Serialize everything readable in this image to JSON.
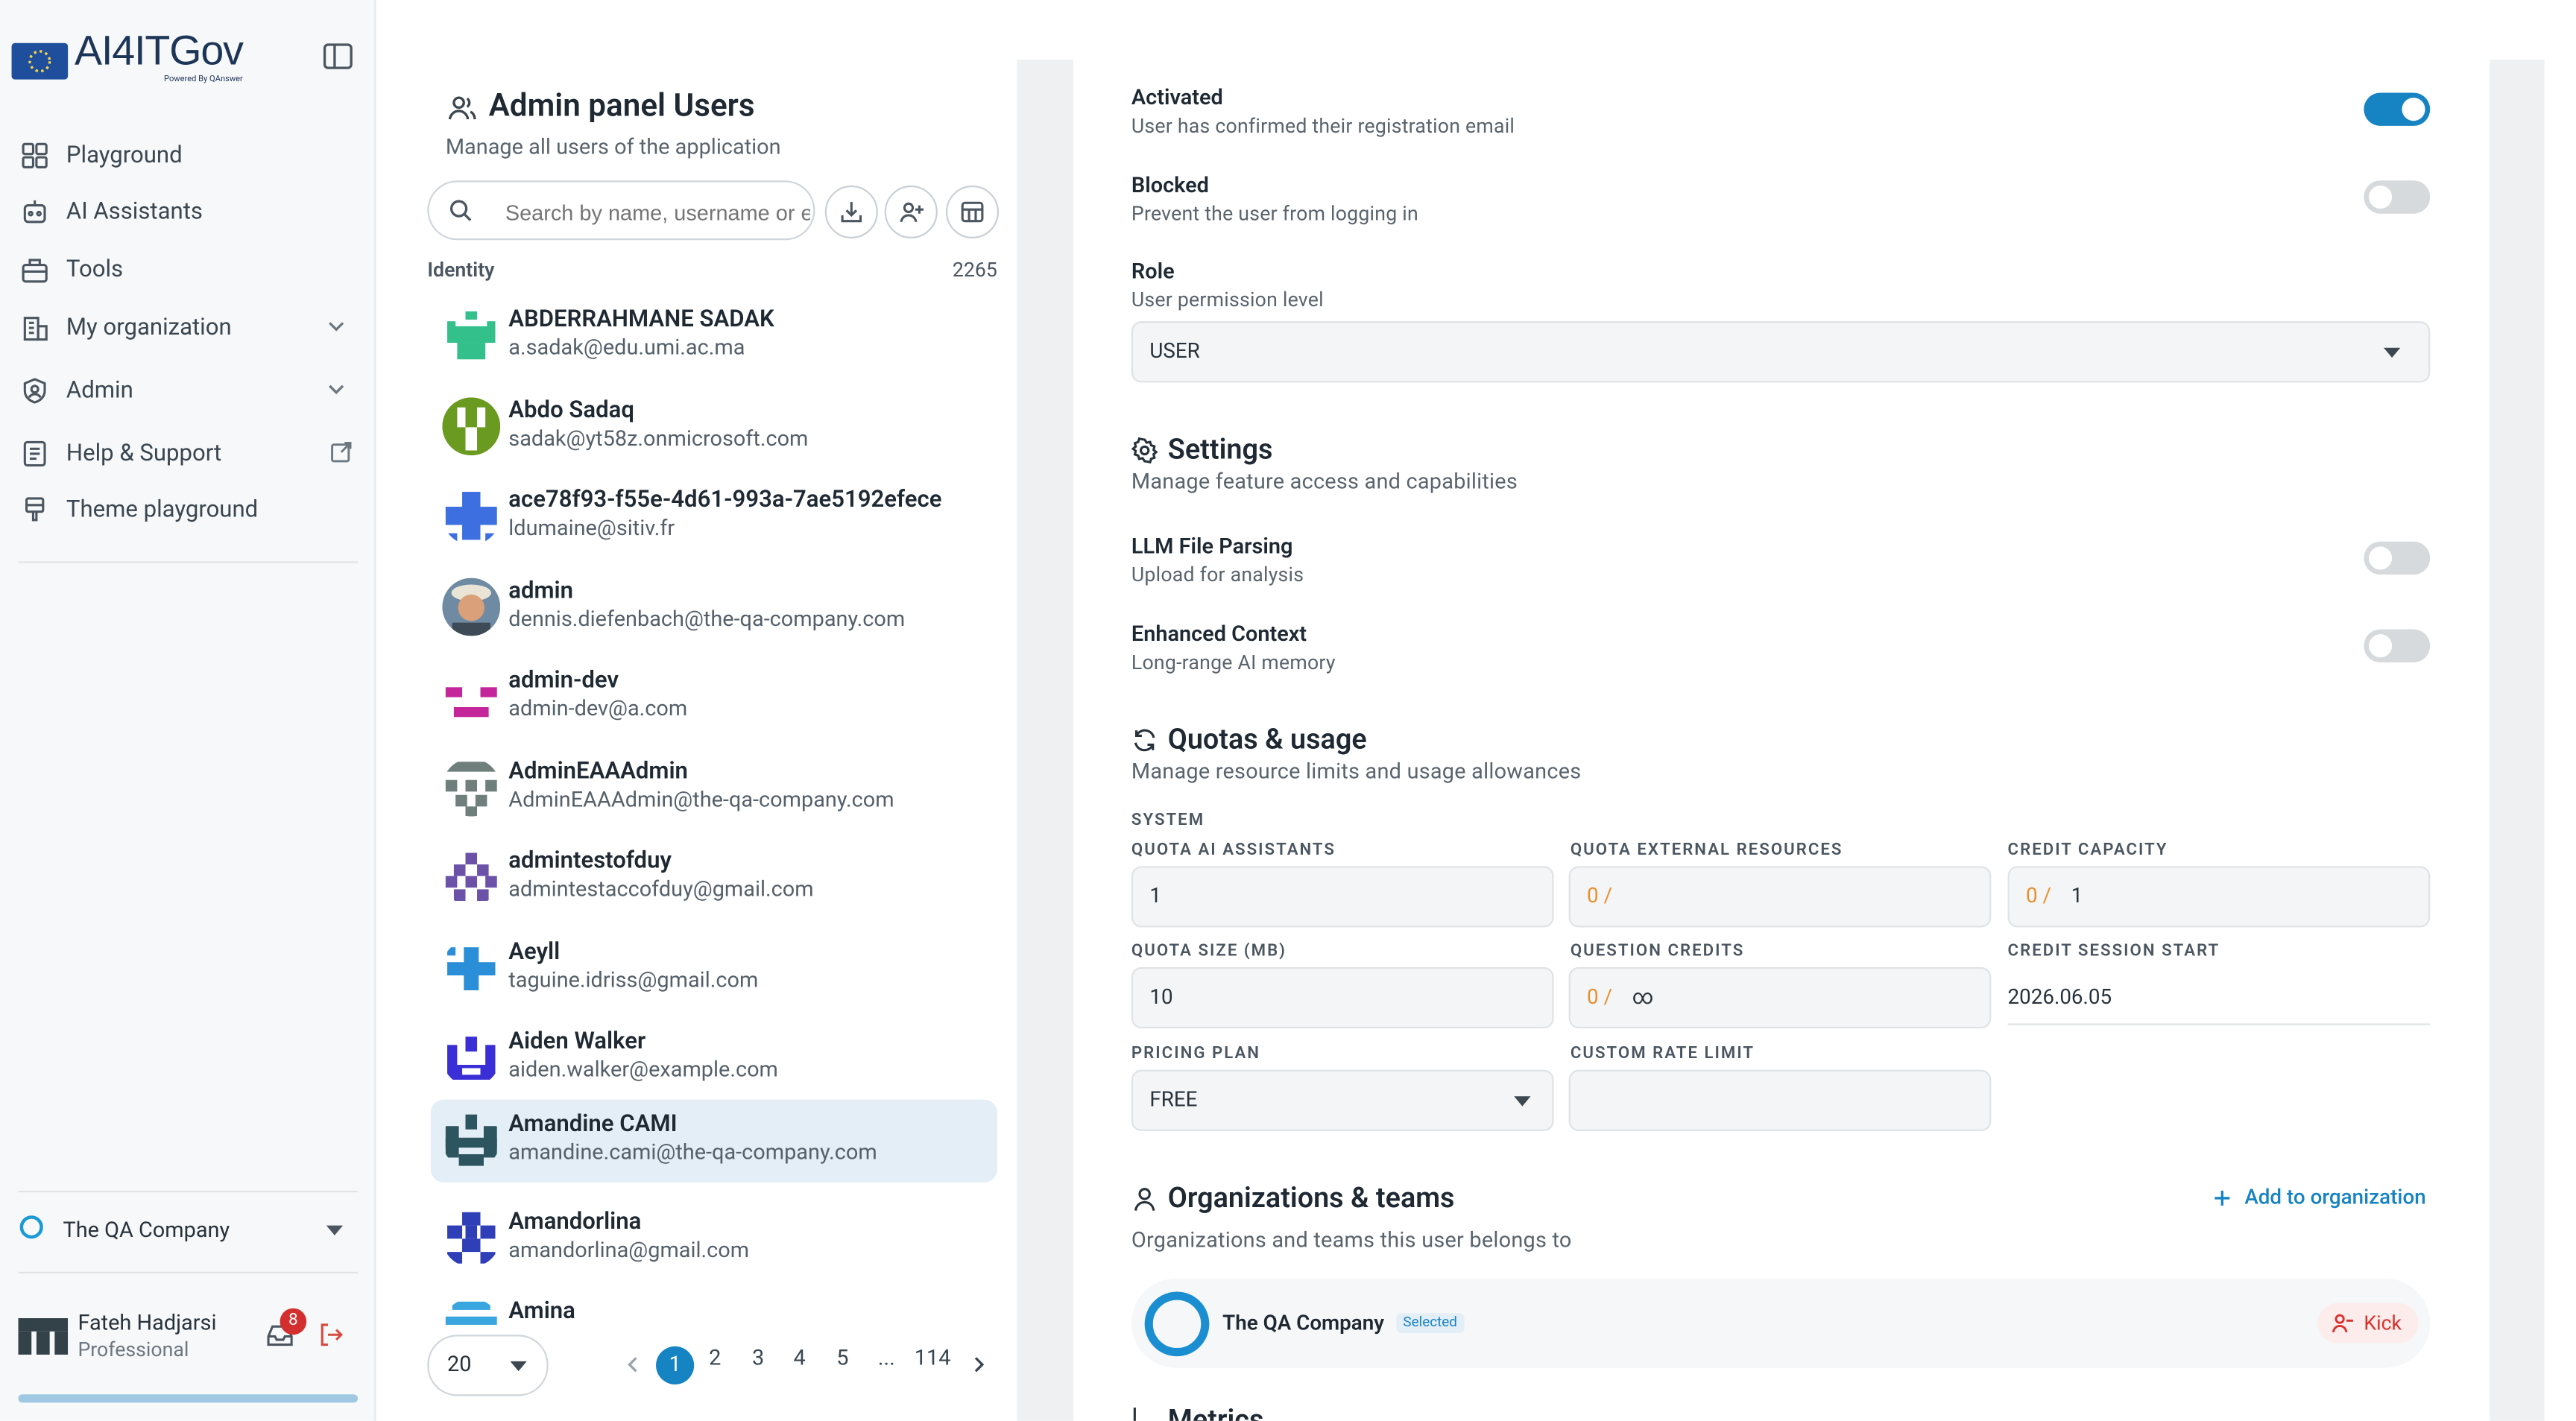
{
  "sidebar": {
    "logo_text": "AI4ITGov",
    "logo_sub": "Powered By QAnswer",
    "items": [
      {
        "label": "Playground",
        "icon": "grid-icon"
      },
      {
        "label": "AI Assistants",
        "icon": "robot-icon"
      },
      {
        "label": "Tools",
        "icon": "toolbox-icon"
      },
      {
        "label": "My organization",
        "icon": "building-icon"
      },
      {
        "label": "Admin",
        "icon": "shield-icon"
      },
      {
        "label": "Help & Support",
        "icon": "document-icon"
      },
      {
        "label": "Theme playground",
        "icon": "brush-icon"
      }
    ],
    "org_selector": "The QA Company",
    "user": {
      "name": "Fateh Hadjarsi",
      "plan": "Professional",
      "notifications": "8"
    }
  },
  "users_panel": {
    "title": "Admin panel Users",
    "subtitle": "Manage all users of the application",
    "search_placeholder": "Search by name, username or email",
    "column_label": "Identity",
    "total_count": "2265",
    "users": [
      {
        "name": "ABDERRAHMANE SADAK",
        "email": "a.sadak@edu.umi.ac.ma"
      },
      {
        "name": "Abdo Sadaq",
        "email": "sadak@yt58z.onmicrosoft.com"
      },
      {
        "name": "ace78f93-f55e-4d61-993a-7ae5192efece",
        "email": "ldumaine@sitiv.fr"
      },
      {
        "name": "admin",
        "email": "dennis.diefenbach@the-qa-company.com"
      },
      {
        "name": "admin-dev",
        "email": "admin-dev@a.com"
      },
      {
        "name": "AdminEAAAdmin",
        "email": "AdminEAAAdmin@the-qa-company.com"
      },
      {
        "name": "admintestofduy",
        "email": "admintestaccofduy@gmail.com"
      },
      {
        "name": "Aeyll",
        "email": "taguine.idriss@gmail.com"
      },
      {
        "name": "Aiden Walker",
        "email": "aiden.walker@example.com"
      },
      {
        "name": "Amandine CAMI",
        "email": "amandine.cami@the-qa-company.com"
      },
      {
        "name": "Amandorlina",
        "email": "amandorlina@gmail.com"
      },
      {
        "name": "Amina",
        "email": ""
      }
    ],
    "page_size": "20",
    "pages": [
      "1",
      "2",
      "3",
      "4",
      "5",
      "...",
      "114"
    ],
    "current_page": "1"
  },
  "detail": {
    "activated": {
      "label": "Activated",
      "desc": "User has confirmed their registration email",
      "on": true
    },
    "blocked": {
      "label": "Blocked",
      "desc": "Prevent the user from logging in",
      "on": false
    },
    "role": {
      "label": "Role",
      "desc": "User permission level",
      "value": "USER"
    },
    "settings": {
      "title": "Settings",
      "desc": "Manage feature access and capabilities",
      "llm": {
        "label": "LLM File Parsing",
        "desc": "Upload for analysis",
        "on": false
      },
      "context": {
        "label": "Enhanced Context",
        "desc": "Long-range AI memory",
        "on": false
      }
    },
    "quotas": {
      "title": "Quotas & usage",
      "desc": "Manage resource limits and usage allowances",
      "system_label": "SYSTEM",
      "quota_ai_label": "QUOTA AI ASSISTANTS",
      "quota_ai_value": "1",
      "quota_ext_label": "QUOTA EXTERNAL RESOURCES",
      "quota_ext_used": "0 /",
      "credit_cap_label": "CREDIT CAPACITY",
      "credit_cap_used": "0 /",
      "credit_cap_value": "1",
      "quota_size_label": "QUOTA SIZE (MB)",
      "quota_size_value": "10",
      "question_credits_label": "QUESTION CREDITS",
      "question_credits_used": "0 /",
      "question_credits_value": "∞",
      "credit_session_label": "CREDIT SESSION START",
      "credit_session_value": "2026.06.05",
      "pricing_label": "PRICING PLAN",
      "pricing_value": "FREE",
      "rate_limit_label": "CUSTOM RATE LIMIT",
      "rate_limit_value": ""
    },
    "orgs": {
      "title": "Organizations & teams",
      "desc": "Organizations and teams this user belongs to",
      "add_label": "Add to organization",
      "org_name": "The QA Company",
      "org_badge": "Selected",
      "kick_label": "Kick"
    },
    "next_section": "Metrics"
  }
}
